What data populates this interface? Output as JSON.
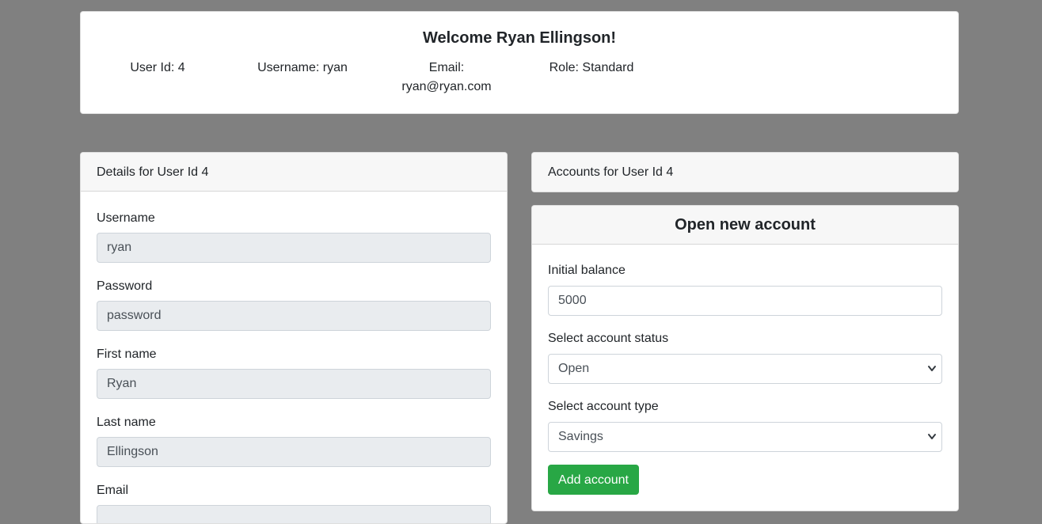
{
  "welcome": {
    "title": "Welcome Ryan Ellingson!",
    "user_id": "User Id: 4",
    "username": "Username: ryan",
    "email_label": "Email:",
    "email_value": "ryan@ryan.com",
    "role": "Role: Standard"
  },
  "details": {
    "header": "Details for User Id 4",
    "fields": [
      {
        "label": "Username",
        "value": "ryan"
      },
      {
        "label": "Password",
        "value": "password"
      },
      {
        "label": "First name",
        "value": "Ryan"
      },
      {
        "label": "Last name",
        "value": "Ellingson"
      },
      {
        "label": "Email",
        "value": ""
      }
    ]
  },
  "accounts": {
    "header": "Accounts for User Id 4"
  },
  "open_account": {
    "header": "Open new account",
    "initial_balance_label": "Initial balance",
    "initial_balance_value": "5000",
    "status_label": "Select account status",
    "status_selected": "Open",
    "type_label": "Select account type",
    "type_selected": "Savings",
    "add_button": "Add account"
  },
  "colors": {
    "background": "#808080",
    "card": "#ffffff",
    "readonly_input": "#e9ecef",
    "button_success": "#28a745"
  },
  "icons": {
    "select_chevron": "chevron-down-icon"
  }
}
